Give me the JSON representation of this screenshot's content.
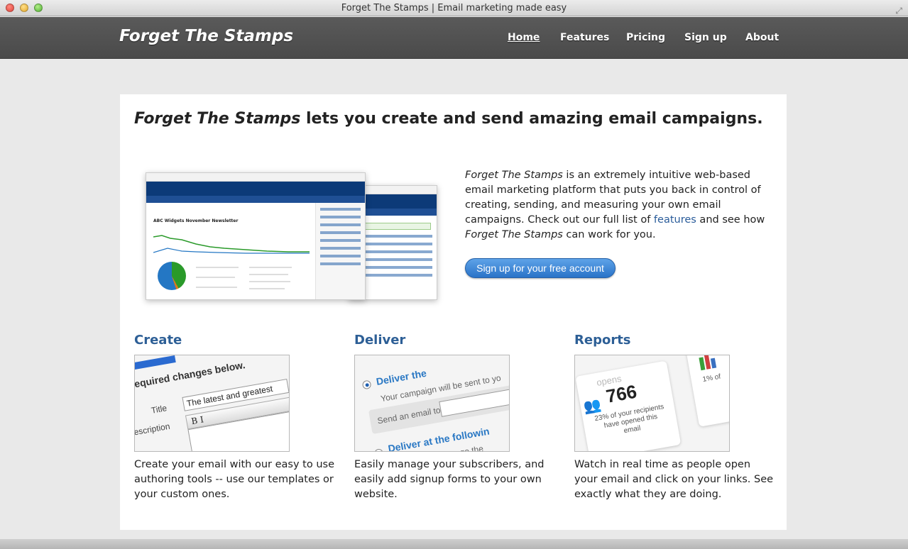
{
  "window": {
    "title": "Forget The Stamps | Email marketing made easy"
  },
  "nav": {
    "brand": "Forget The Stamps",
    "items": [
      {
        "label": "Home",
        "active": true
      },
      {
        "label": "Features"
      },
      {
        "label": "Pricing"
      },
      {
        "label": "Sign up"
      },
      {
        "label": "About"
      }
    ]
  },
  "hero": {
    "headline_brand": "Forget The Stamps",
    "headline_rest": " lets you create and send amazing email campaigns.",
    "screenshot_title": "ABC Widgets November Newsletter",
    "intro_brand": "Forget The Stamps",
    "intro_part1": " is an extremely intuitive web-based email marketing platform that puts you back in control of creating, sending, and measuring your own email campaigns. Check out our full list of ",
    "intro_link": "features",
    "intro_part2": " and see how ",
    "intro_brand2": "Forget The Stamps",
    "intro_part3": " can work for you.",
    "signup_button": "Sign up for your free account"
  },
  "features": [
    {
      "title": "Create",
      "desc": "Create your email with our easy to use authoring tools -- use our templates or your custom ones.",
      "thumb": {
        "heading": "e required changes below.",
        "title_label": "Title",
        "title_value": "The latest and greatest",
        "desc_label": "Description",
        "toolbar": "B I"
      }
    },
    {
      "title": "Deliver",
      "desc": "Easily manage your subscribers, and easily add signup forms to your own website.",
      "thumb": {
        "option1": "Deliver the",
        "sent_text": "Your campaign will be sent to yo",
        "send_label": "Send an email to",
        "option2": "Deliver at the followin",
        "change_text": "ways change the"
      }
    },
    {
      "title": "Reports",
      "desc": "Watch in real time as people open your email and click on your links. See exactly what they are doing.",
      "thumb": {
        "opens_label": "opens",
        "opens_value": "766",
        "opens_sub": "23% of your recipients have opened this email",
        "side_pct": "1% of"
      }
    }
  ],
  "colors": {
    "navbar": "#4f4f4f",
    "link": "#2d5f96",
    "button": "#3a86d8"
  }
}
